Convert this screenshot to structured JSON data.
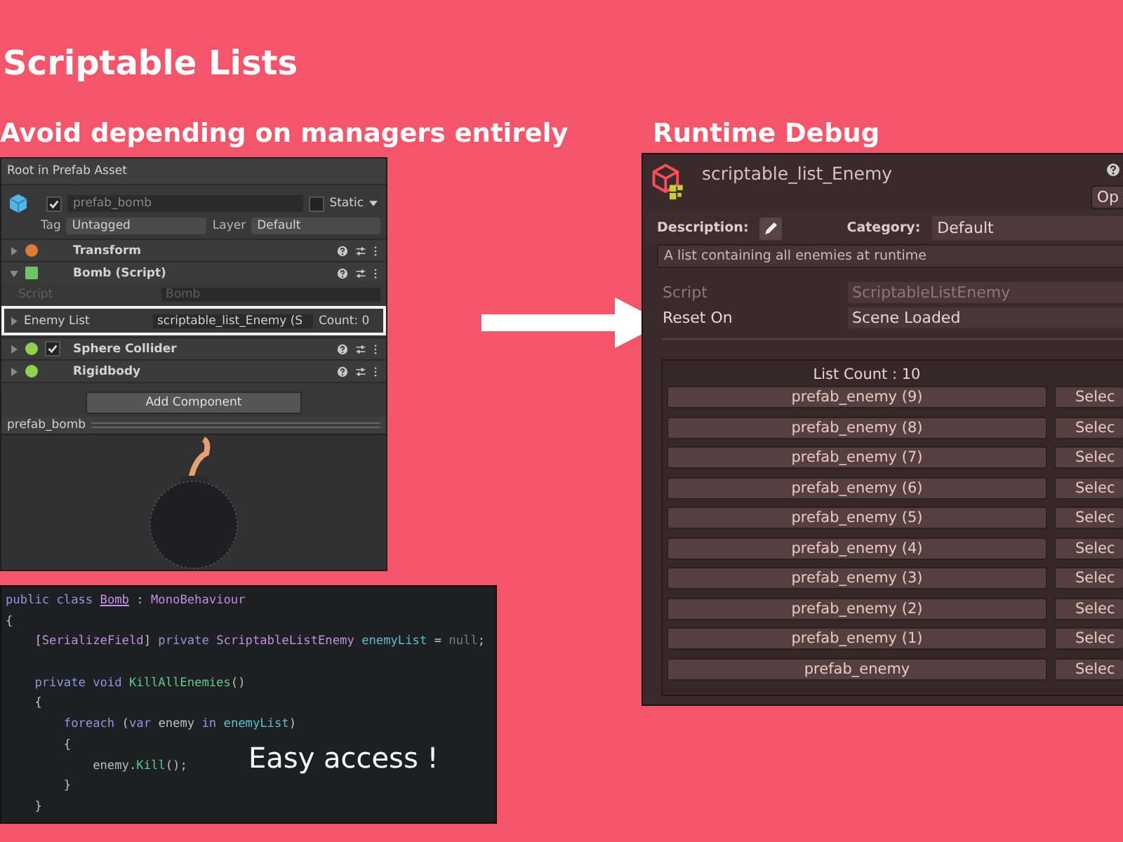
{
  "title": "Scriptable Lists",
  "left_heading": "Avoid depending on managers entirely",
  "right_heading": "Runtime Debug",
  "inspector": {
    "header": "Root in Prefab Asset",
    "object_name": "prefab_bomb",
    "active": true,
    "static": false,
    "static_label": "Static",
    "tag_label": "Tag",
    "tag_value": "Untagged",
    "layer_label": "Layer",
    "layer_value": "Default",
    "components": [
      {
        "kind": "transform",
        "name": "Transform",
        "expanded": false
      },
      {
        "kind": "script",
        "name": "Bomb (Script)",
        "expanded": true,
        "fields": [
          {
            "label": "Script",
            "value": "Bomb",
            "disabled": true,
            "highlighted": false
          },
          {
            "label": "Enemy List",
            "value": "scriptable_list_Enemy (S",
            "count": "Count: 0",
            "disabled": false,
            "highlighted": true
          }
        ]
      },
      {
        "kind": "collider",
        "name": "Sphere Collider",
        "expanded": false,
        "enabled": true
      },
      {
        "kind": "rigidbody",
        "name": "Rigidbody",
        "expanded": false
      }
    ],
    "add_button": "Add Component",
    "preview_title": "prefab_bomb"
  },
  "code": {
    "lines": [
      {
        "gap_before": false,
        "tokens": [
          {
            "text": "public class ",
            "kind": "keyword"
          },
          {
            "text": "Bomb",
            "kind": "class"
          },
          {
            "text": " : ",
            "kind": "plain"
          },
          {
            "text": "MonoBehaviour",
            "kind": "type"
          }
        ]
      },
      {
        "gap_before": false,
        "tokens": [
          {
            "text": "{",
            "kind": "plain"
          }
        ]
      },
      {
        "gap_before": false,
        "tokens": [
          {
            "text": "    [",
            "kind": "plain"
          },
          {
            "text": "SerializeField",
            "kind": "type"
          },
          {
            "text": "] ",
            "kind": "plain"
          },
          {
            "text": "private ",
            "kind": "keyword"
          },
          {
            "text": "ScriptableListEnemy ",
            "kind": "type"
          },
          {
            "text": "enemyList",
            "kind": "field"
          },
          {
            "text": " = ",
            "kind": "plain"
          },
          {
            "text": "null",
            "kind": "dim"
          },
          {
            "text": ";",
            "kind": "plain"
          }
        ]
      },
      {
        "gap_before": true,
        "tokens": [
          {
            "text": "    private void ",
            "kind": "keyword"
          },
          {
            "text": "KillAllEnemies",
            "kind": "method"
          },
          {
            "text": "()",
            "kind": "plain"
          }
        ]
      },
      {
        "gap_before": false,
        "tokens": [
          {
            "text": "    {",
            "kind": "plain"
          }
        ]
      },
      {
        "gap_before": false,
        "tokens": [
          {
            "text": "        foreach ",
            "kind": "keyword"
          },
          {
            "text": "(",
            "kind": "plain"
          },
          {
            "text": "var ",
            "kind": "keyword"
          },
          {
            "text": "enemy ",
            "kind": "plain"
          },
          {
            "text": "in ",
            "kind": "keyword"
          },
          {
            "text": "enemyList",
            "kind": "field"
          },
          {
            "text": ")",
            "kind": "plain"
          }
        ]
      },
      {
        "gap_before": false,
        "tokens": [
          {
            "text": "        {",
            "kind": "plain"
          }
        ]
      },
      {
        "gap_before": false,
        "tokens": [
          {
            "text": "            enemy.",
            "kind": "plain"
          },
          {
            "text": "Kill",
            "kind": "method"
          },
          {
            "text": "();",
            "kind": "plain"
          }
        ]
      },
      {
        "gap_before": false,
        "tokens": [
          {
            "text": "        }",
            "kind": "plain"
          }
        ]
      },
      {
        "gap_before": false,
        "tokens": [
          {
            "text": "    }",
            "kind": "plain"
          }
        ]
      }
    ],
    "caption": "Easy access !"
  },
  "debug": {
    "asset_name": "scriptable_list_Enemy",
    "open_button": "Op",
    "description_label": "Description:",
    "category_label": "Category:",
    "category_value": "Default",
    "description": "A list containing all enemies at runtime",
    "script_label": "Script",
    "script_value": "ScriptableListEnemy",
    "reset_label": "Reset On",
    "reset_value": "Scene Loaded",
    "list_count": "List Count : 10",
    "items": [
      {
        "name": "prefab_enemy (9)",
        "select": "Selec"
      },
      {
        "name": "prefab_enemy (8)",
        "select": "Selec"
      },
      {
        "name": "prefab_enemy (7)",
        "select": "Selec"
      },
      {
        "name": "prefab_enemy (6)",
        "select": "Selec"
      },
      {
        "name": "prefab_enemy (5)",
        "select": "Selec"
      },
      {
        "name": "prefab_enemy (4)",
        "select": "Selec"
      },
      {
        "name": "prefab_enemy (3)",
        "select": "Selec"
      },
      {
        "name": "prefab_enemy (2)",
        "select": "Selec"
      },
      {
        "name": "prefab_enemy (1)",
        "select": "Selec"
      },
      {
        "name": "prefab_enemy",
        "select": "Selec"
      }
    ]
  }
}
